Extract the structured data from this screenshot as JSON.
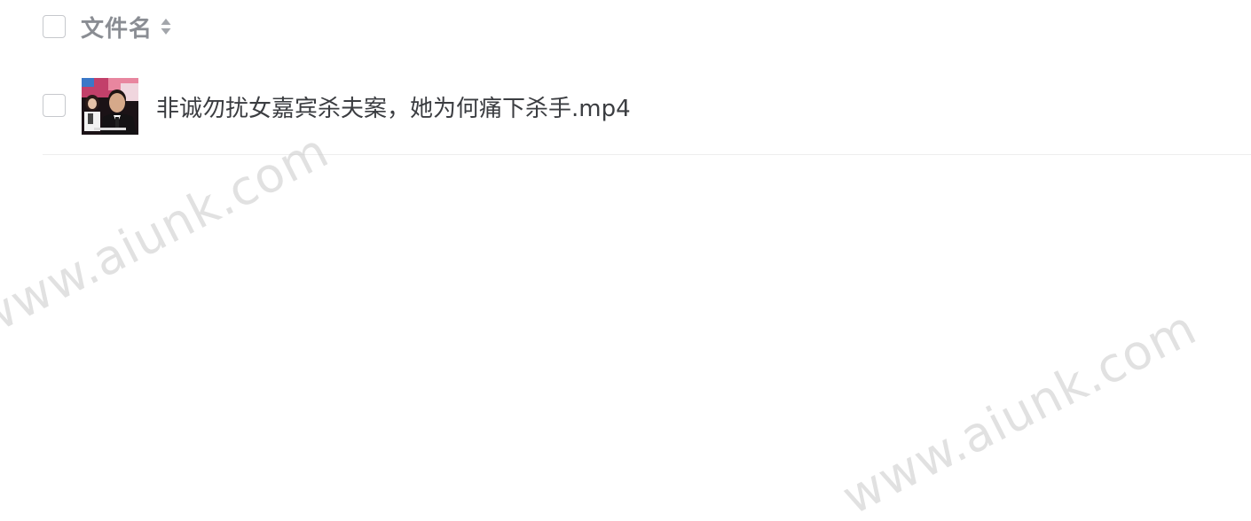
{
  "header": {
    "column_label": "文件名",
    "sort_icon": "sort-updown-icon"
  },
  "files": [
    {
      "name": "非诚勿扰女嘉宾杀夫案，她为何痛下杀手.mp4",
      "thumbnail": "video-thumbnail"
    }
  ],
  "watermark": {
    "text": "www.aiunk.com"
  },
  "colors": {
    "header_text": "#8a8d93",
    "file_text": "#3b3d41",
    "checkbox_border": "#c6c8cc",
    "row_divider": "#eeeeee"
  }
}
